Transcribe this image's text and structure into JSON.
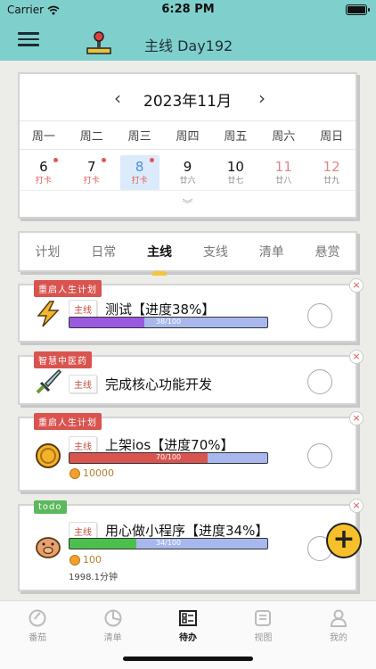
{
  "status_bar": {
    "carrier": "Carrier",
    "time": "6:28 PM"
  },
  "header": {
    "title": "主线 Day192",
    "menu_icon": "menu-icon",
    "logo_icon": "joystick-icon"
  },
  "calendar": {
    "month_label": "2023年11月",
    "prev_icon": "chevron-left-icon",
    "next_icon": "chevron-right-icon",
    "weekdays": [
      "周一",
      "周二",
      "周三",
      "周四",
      "周五",
      "周六",
      "周日"
    ],
    "days": [
      {
        "num": "6",
        "sub": "打卡",
        "dot": true
      },
      {
        "num": "7",
        "sub": "打卡",
        "dot": true
      },
      {
        "num": "8",
        "sub": "打卡",
        "dot": true,
        "selected": true
      },
      {
        "num": "9",
        "sub": "廿六",
        "dot": false
      },
      {
        "num": "10",
        "sub": "廿七",
        "dot": false
      },
      {
        "num": "11",
        "sub": "廿八",
        "dot": false,
        "weekend": true
      },
      {
        "num": "12",
        "sub": "廿九",
        "dot": false,
        "weekend": true
      }
    ],
    "expand_label": "︾"
  },
  "tabs": [
    {
      "label": "计划",
      "active": false
    },
    {
      "label": "日常",
      "active": false
    },
    {
      "label": "主线",
      "active": true
    },
    {
      "label": "支线",
      "active": false
    },
    {
      "label": "清单",
      "active": false
    },
    {
      "label": "悬赏",
      "active": false
    }
  ],
  "tasks": [
    {
      "tag": "重启人生计划",
      "tag_color": "#d9534f",
      "category": "主线",
      "title": "测试【进度38%】",
      "progress": 38,
      "progress_label": "38/100",
      "progress_color": "#9a5ae0",
      "icon": "lightning-icon"
    },
    {
      "tag": "智慧中医药",
      "tag_color": "#d9534f",
      "category": "主线",
      "title": "完成核心功能开发",
      "icon": "sword-icon"
    },
    {
      "tag": "重启人生计划",
      "tag_color": "#d9534f",
      "category": "主线",
      "title": "上架ios【进度70%】",
      "progress": 70,
      "progress_label": "70/100",
      "progress_color": "#d9534f",
      "coins": "10000",
      "icon": "gold-coin-icon"
    },
    {
      "tag": "todo",
      "tag_color": "#5cb85c",
      "category": "主线",
      "title": "用心做小程序【进度34%】",
      "progress": 34,
      "progress_label": "34/100",
      "progress_color": "#4cc04c",
      "coins": "100",
      "duration": "1998.1分钟",
      "icon": "pig-icon"
    }
  ],
  "fab": {
    "label": "+"
  },
  "bottom_nav": [
    {
      "label": "番茄",
      "icon": "tomato-timer-icon",
      "active": false
    },
    {
      "label": "清单",
      "icon": "pie-chart-icon",
      "active": false
    },
    {
      "label": "待办",
      "icon": "todo-board-icon",
      "active": true
    },
    {
      "label": "视图",
      "icon": "note-icon",
      "active": false
    },
    {
      "label": "我的",
      "icon": "user-icon",
      "active": false
    }
  ],
  "colors": {
    "header_bg": "#7fd0cd",
    "accent_yellow": "#f7c02a",
    "selected_day_bg": "#dcebfb"
  }
}
